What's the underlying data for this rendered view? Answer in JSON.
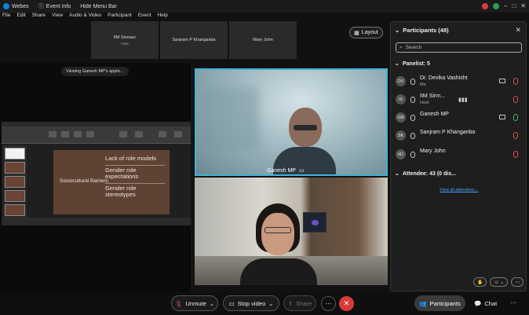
{
  "titlebar": {
    "app": "Webex",
    "event_info": "Event Info",
    "hide_menu": "Hide Menu Bar"
  },
  "menu": [
    "File",
    "Edit",
    "Share",
    "View",
    "Audio & Video",
    "Participant",
    "Event",
    "Help"
  ],
  "strip": [
    {
      "name": "IIM Sirmaur",
      "role": "Host"
    },
    {
      "name": "Sanjram P Khanganba",
      "role": ""
    },
    {
      "name": "Mary John",
      "role": ""
    }
  ],
  "layout_label": "Layout",
  "viewing_label": "Viewing Ganesh MP's applic...",
  "slide": {
    "header": "Sociocultural Barriers",
    "items": [
      "Lack of role models",
      "Gender role expectations",
      "Gender role stereotypes"
    ]
  },
  "video_name": "Ganesh MP",
  "panel": {
    "title": "Participants (48)",
    "search_placeholder": "Search",
    "panelist_label": "Panelist: 5",
    "attendee_label": "Attendee: 43 (0 dis...",
    "view_all": "View all attendees...",
    "panelists": [
      {
        "initials": "DV",
        "name": "Dr. Devika Vashisht",
        "role": "Me"
      },
      {
        "initials": "IS",
        "name": "IIM Sirm...",
        "role": "Host"
      },
      {
        "initials": "GM",
        "name": "Ganesh MP",
        "role": ""
      },
      {
        "initials": "SK",
        "name": "Sanjram P Khanganba",
        "role": ""
      },
      {
        "initials": "MJ",
        "name": "Mary John",
        "role": ""
      }
    ]
  },
  "bottom": {
    "unmute": "Unmute",
    "stop_video": "Stop video",
    "share": "Share",
    "participants": "Participants",
    "chat": "Chat"
  }
}
